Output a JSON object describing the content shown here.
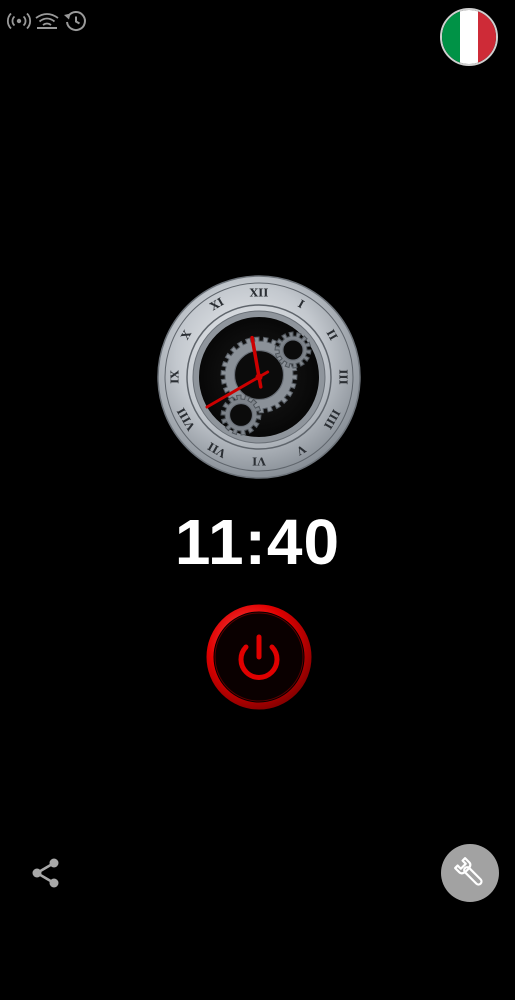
{
  "status_bar": {
    "icons": [
      "broadcast-signal-icon",
      "wifi-icon",
      "history-clock-icon"
    ]
  },
  "language_flag": {
    "icon": "italy-flag-icon",
    "colors": [
      "#009246",
      "#ffffff",
      "#ce2b37"
    ]
  },
  "clock": {
    "numerals": [
      "XII",
      "I",
      "II",
      "III",
      "IIII",
      "V",
      "VI",
      "VII",
      "VIII",
      "IX",
      "X",
      "XI"
    ],
    "hour_hand_color": "#cc0000",
    "minute_hand_color": "#cc0000"
  },
  "time": {
    "display": "11:40"
  },
  "power": {
    "icon": "power-icon",
    "color": "#e00000"
  },
  "footer": {
    "share_icon": "share-icon",
    "settings_icon": "wrench-icon"
  }
}
